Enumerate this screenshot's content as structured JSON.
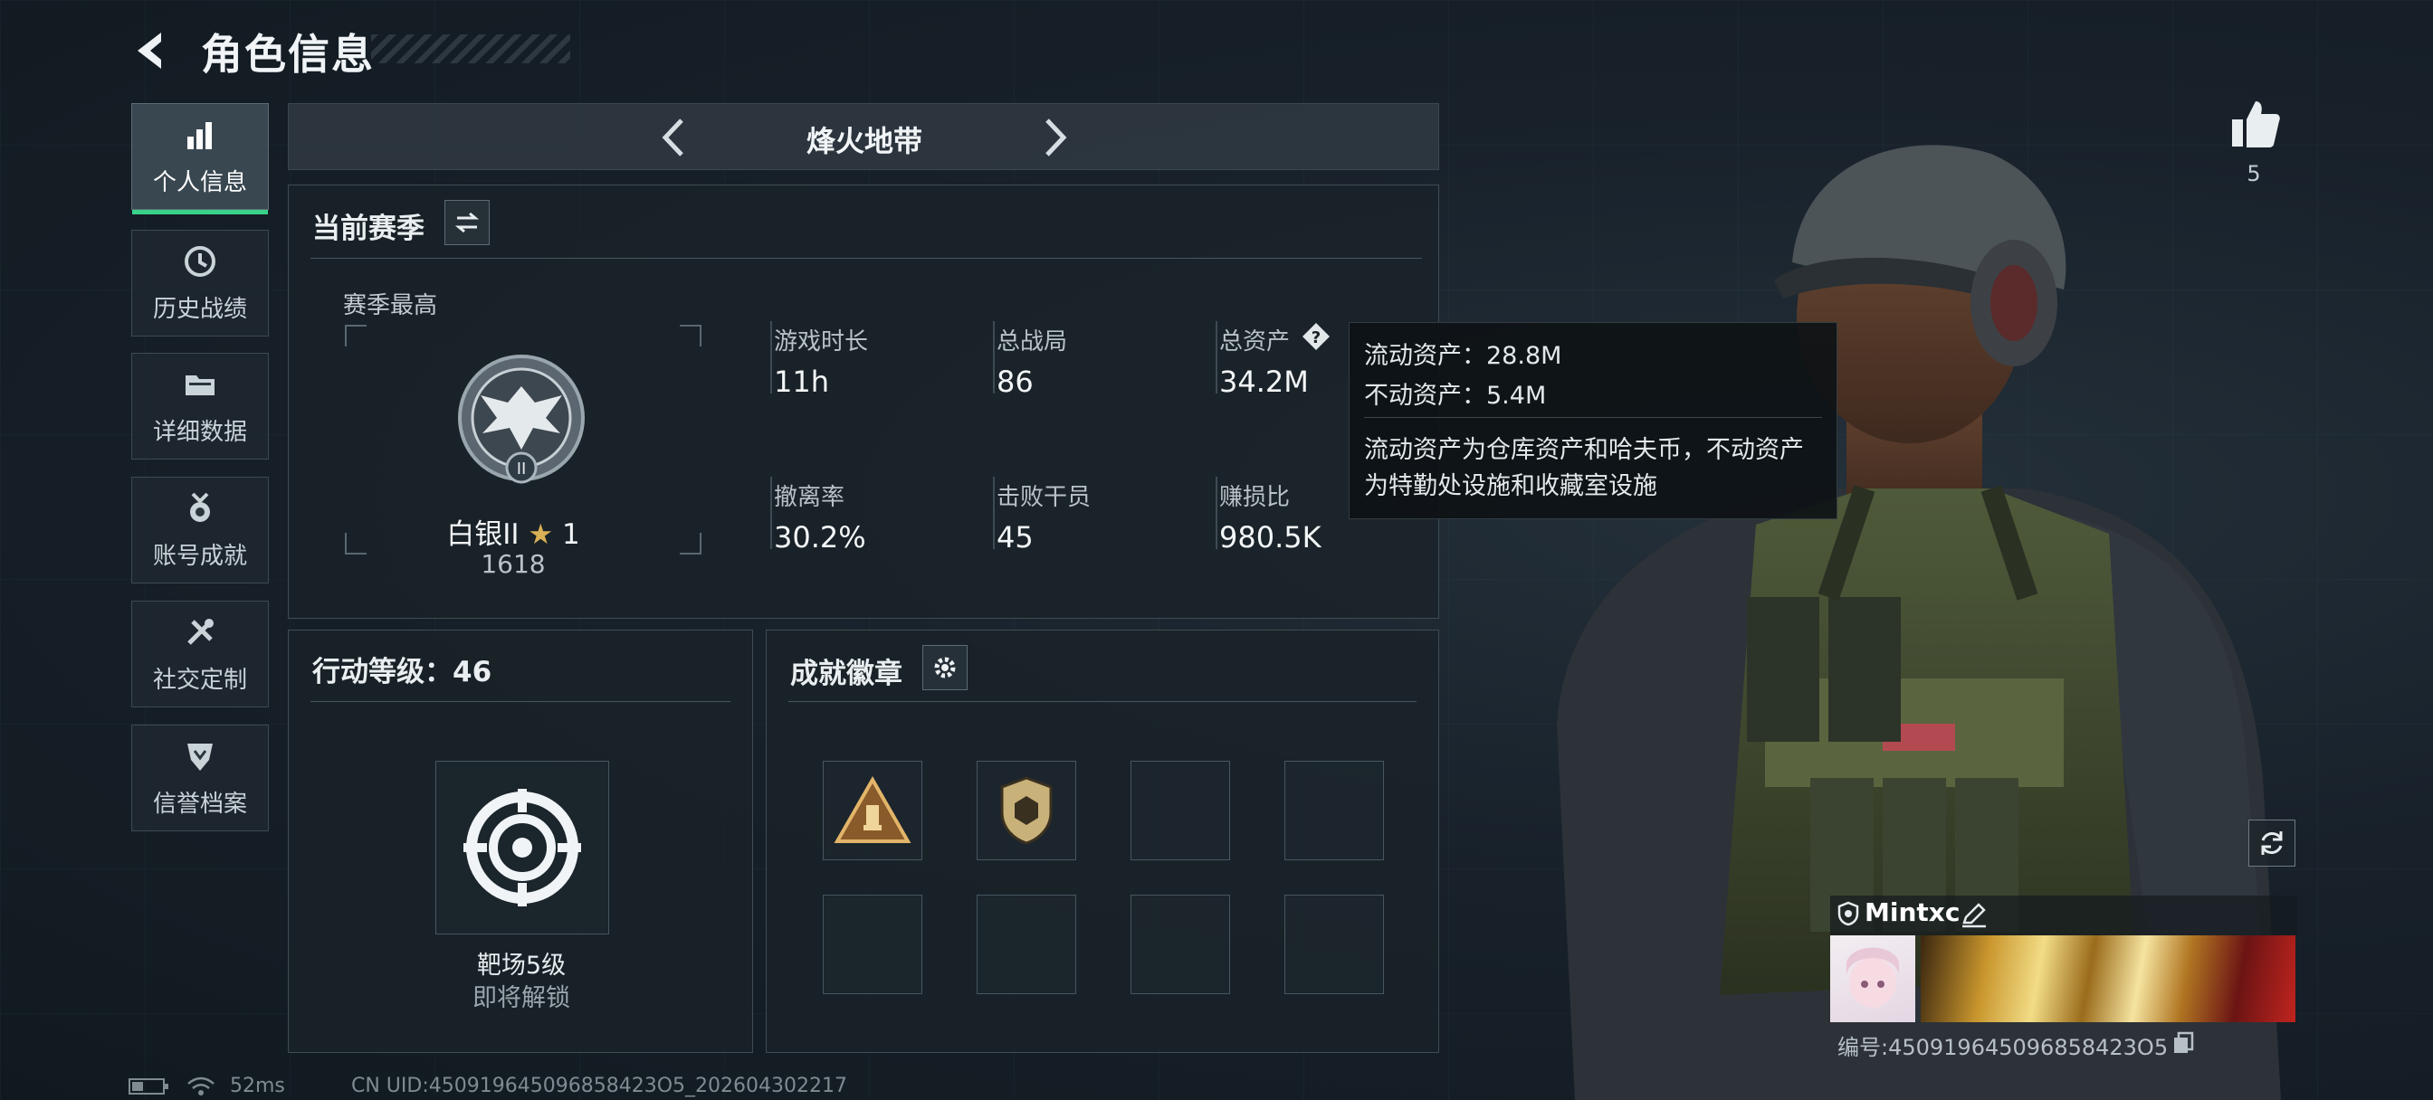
{
  "header": {
    "title": "角色信息"
  },
  "nav": {
    "items": [
      {
        "label": "个人信息",
        "active": true
      },
      {
        "label": "历史战绩"
      },
      {
        "label": "详细数据"
      },
      {
        "label": "账号成就"
      },
      {
        "label": "社交定制"
      },
      {
        "label": "信誉档案"
      }
    ]
  },
  "mode": {
    "title": "烽火地带"
  },
  "season": {
    "title": "当前赛季",
    "best_label": "赛季最高",
    "rank_name": "白银II",
    "rank_stars": "1",
    "rank_score": "1618",
    "stats": [
      {
        "label": "游戏时长",
        "value": "11h"
      },
      {
        "label": "总战局",
        "value": "86"
      },
      {
        "label": "总资产",
        "value": "34.2M"
      },
      {
        "label": "撤离率",
        "value": "30.2%"
      },
      {
        "label": "击败干员",
        "value": "45"
      },
      {
        "label": "赚损比",
        "value": "980.5K"
      }
    ]
  },
  "tooltip": {
    "liquid": "流动资产：28.8M",
    "fixed": "不动资产：5.4M",
    "desc_line1": "流动资产为仓库资产和哈夫币，不动资产",
    "desc_line2": "为特勤处设施和收藏室设施"
  },
  "action_level": {
    "title": "行动等级：46",
    "item_name": "靶场5级",
    "item_status": "即将解锁"
  },
  "achievements": {
    "title": "成就徽章"
  },
  "profile": {
    "likes": "5",
    "player_name": "Mintxc",
    "player_id": "编号:450919645096858423O5"
  },
  "status": {
    "ping": "52ms",
    "uid": "CN UID:450919645096858423O5_202604302217"
  },
  "colors": {
    "accent": "#39d28a",
    "panel": "#1a2228"
  }
}
